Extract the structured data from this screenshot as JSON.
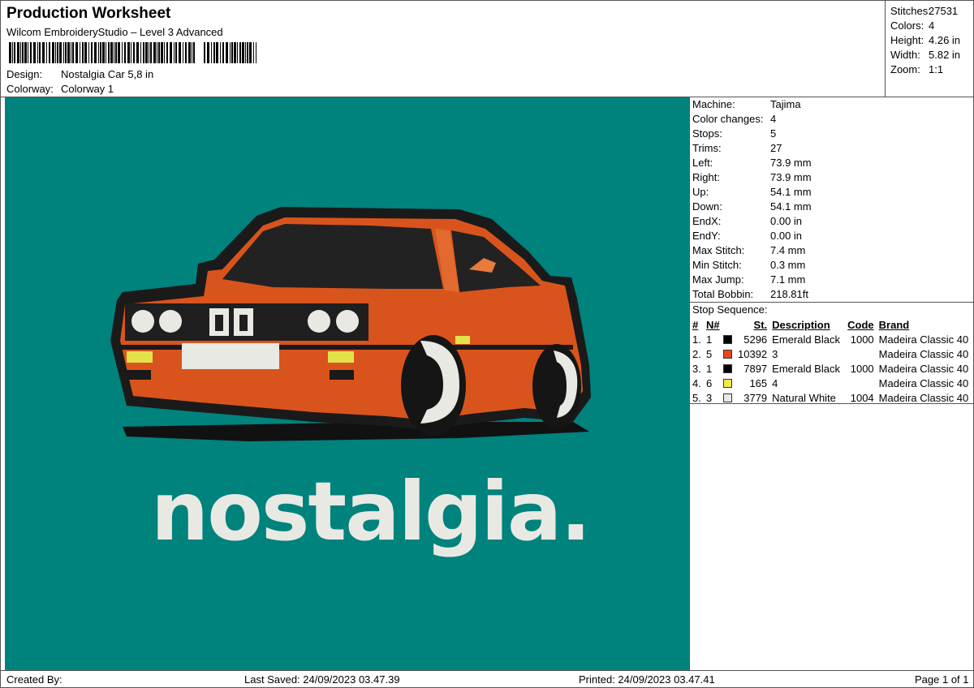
{
  "header": {
    "title": "Production Worksheet",
    "subtitle": "Wilcom EmbroideryStudio – Level 3 Advanced",
    "design_label": "Design:",
    "design_value": "Nostalgia Car 5,8 in",
    "colorway_label": "Colorway:",
    "colorway_value": "Colorway 1"
  },
  "summary": {
    "stitches_label": "Stitches:",
    "stitches": "27531",
    "colors_label": "Colors:",
    "colors": "4",
    "height_label": "Height:",
    "height": "4.26 in",
    "width_label": "Width:",
    "width": "5.82 in",
    "zoom_label": "Zoom:",
    "zoom": "1:1"
  },
  "machine": {
    "rows": [
      {
        "label": "Machine:",
        "value": "Tajima"
      },
      {
        "label": "Color changes:",
        "value": "4"
      },
      {
        "label": "Stops:",
        "value": "5"
      },
      {
        "label": "Trims:",
        "value": "27"
      },
      {
        "label": "Left:",
        "value": "73.9 mm"
      },
      {
        "label": "Right:",
        "value": "73.9 mm"
      },
      {
        "label": "Up:",
        "value": "54.1 mm"
      },
      {
        "label": "Down:",
        "value": "54.1 mm"
      },
      {
        "label": "EndX:",
        "value": "0.00 in"
      },
      {
        "label": "EndY:",
        "value": "0.00 in"
      },
      {
        "label": "Max Stitch:",
        "value": "7.4 mm"
      },
      {
        "label": "Min Stitch:",
        "value": "0.3 mm"
      },
      {
        "label": "Max Jump:",
        "value": "7.1 mm"
      },
      {
        "label": "Total Bobbin:",
        "value": "218.81ft"
      }
    ]
  },
  "stop_sequence": {
    "label": "Stop Sequence:",
    "headers": {
      "num": "#",
      "n": "N#",
      "st": "St.",
      "desc": "Description",
      "code": "Code",
      "brand": "Brand"
    },
    "rows": [
      {
        "num": "1.",
        "n": "1",
        "color": "#000000",
        "st": "5296",
        "desc": "Emerald Black",
        "code": "1000",
        "brand": "Madeira Classic 40"
      },
      {
        "num": "2.",
        "n": "5",
        "color": "#e8461a",
        "st": "10392",
        "desc": "3",
        "code": "",
        "brand": "Madeira Classic 40"
      },
      {
        "num": "3.",
        "n": "1",
        "color": "#000000",
        "st": "7897",
        "desc": "Emerald Black",
        "code": "1000",
        "brand": "Madeira Classic 40"
      },
      {
        "num": "4.",
        "n": "6",
        "color": "#f2e94e",
        "st": "165",
        "desc": "4",
        "code": "",
        "brand": "Madeira Classic 40"
      },
      {
        "num": "5.",
        "n": "3",
        "color": "#e8e8ee",
        "st": "3779",
        "desc": "Natural White",
        "code": "1004",
        "brand": "Madeira Classic 40"
      }
    ]
  },
  "design": {
    "text": "nostalgia.",
    "background_color": "#00827d",
    "body_color": "#d9541c",
    "outline_color": "#1a1a1a",
    "white_color": "#e9e9e4",
    "yellow_color": "#e4e24a"
  },
  "footer": {
    "created_by": "Created By:",
    "last_saved": "Last Saved: 24/09/2023 03.47.39",
    "printed": "Printed: 24/09/2023 03.47.41",
    "page": "Page 1 of 1"
  }
}
